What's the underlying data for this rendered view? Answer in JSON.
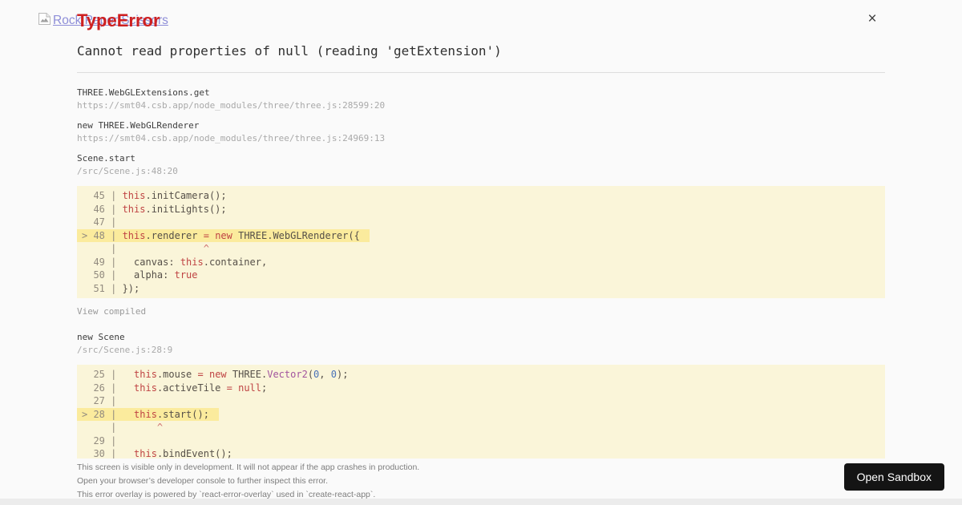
{
  "header": {
    "title": "TypeError",
    "message": "Cannot read properties of null (reading 'getExtension')",
    "broken_image_alt": "Rock Paper Scissors",
    "close_label": "×"
  },
  "stack_frames": [
    {
      "fn": "THREE.WebGLExtensions.get",
      "loc": "https://smt04.csb.app/node_modules/three/three.js:28599:20"
    },
    {
      "fn": "new THREE.WebGLRenderer",
      "loc": "https://smt04.csb.app/node_modules/three/three.js:24969:13"
    },
    {
      "fn": "Scene.start",
      "loc": "/src/Scene.js:48:20",
      "code": 0,
      "after_link": "View compiled"
    },
    {
      "fn": "new Scene",
      "loc": "/src/Scene.js:28:9",
      "code": 1
    }
  ],
  "code_blocks": [
    {
      "lines": [
        {
          "gutter": "  45 | ",
          "tokens": [
            [
              "kw",
              "this"
            ],
            [
              "pl",
              ".initCamera();"
            ]
          ]
        },
        {
          "gutter": "  46 | ",
          "tokens": [
            [
              "kw",
              "this"
            ],
            [
              "pl",
              ".initLights();"
            ]
          ]
        },
        {
          "gutter": "  47 | ",
          "tokens": []
        },
        {
          "gutter": "> 48 | ",
          "highlight": true,
          "tokens": [
            [
              "kw",
              "this"
            ],
            [
              "pl",
              ".renderer "
            ],
            [
              "kw",
              "= "
            ],
            [
              "kw",
              "new "
            ],
            [
              "pl",
              "THREE.WebGLRenderer({"
            ]
          ]
        },
        {
          "gutter": "     | ",
          "tokens": [
            [
              "caret",
              "              ^"
            ]
          ]
        },
        {
          "gutter": "  49 | ",
          "tokens": [
            [
              "pl",
              "  canvas: "
            ],
            [
              "kw",
              "this"
            ],
            [
              "pl",
              ".container,"
            ]
          ]
        },
        {
          "gutter": "  50 | ",
          "tokens": [
            [
              "pl",
              "  alpha: "
            ],
            [
              "kw",
              "true"
            ]
          ]
        },
        {
          "gutter": "  51 | ",
          "tokens": [
            [
              "pl",
              "});"
            ]
          ]
        }
      ]
    },
    {
      "lines": [
        {
          "gutter": "  25 | ",
          "tokens": [
            [
              "pl",
              "  "
            ],
            [
              "kw",
              "this"
            ],
            [
              "pl",
              ".mouse "
            ],
            [
              "kw",
              "= "
            ],
            [
              "kw",
              "new "
            ],
            [
              "pl",
              "THREE."
            ],
            [
              "cls",
              "Vector2"
            ],
            [
              "pl",
              "("
            ],
            [
              "num",
              "0"
            ],
            [
              "pl",
              ", "
            ],
            [
              "num",
              "0"
            ],
            [
              "pl",
              ");"
            ]
          ]
        },
        {
          "gutter": "  26 | ",
          "tokens": [
            [
              "pl",
              "  "
            ],
            [
              "kw",
              "this"
            ],
            [
              "pl",
              ".activeTile "
            ],
            [
              "kw",
              "= "
            ],
            [
              "kw",
              "null"
            ],
            [
              "pl",
              ";"
            ]
          ]
        },
        {
          "gutter": "  27 | ",
          "tokens": []
        },
        {
          "gutter": "> 28 | ",
          "highlight": true,
          "tokens": [
            [
              "pl",
              "  "
            ],
            [
              "kw",
              "this"
            ],
            [
              "pl",
              ".start();"
            ]
          ]
        },
        {
          "gutter": "     | ",
          "tokens": [
            [
              "caret",
              "      ^"
            ]
          ]
        },
        {
          "gutter": "  29 | ",
          "tokens": []
        },
        {
          "gutter": "  30 | ",
          "tokens": [
            [
              "pl",
              "  "
            ],
            [
              "kw",
              "this"
            ],
            [
              "pl",
              ".bindEvent();"
            ]
          ]
        }
      ]
    }
  ],
  "footer": {
    "lines": [
      "This screen is visible only in development. It will not appear if the app crashes in production.",
      "Open your browser’s developer console to further inspect this error.",
      "This error overlay is powered by `react-error-overlay` used in `create-react-app`."
    ],
    "open_sandbox_label": "Open Sandbox"
  },
  "colors": {
    "page_bg": "#fafafa",
    "title_red": "#ce2020",
    "code_bg": "#faf5d9",
    "code_highlight_bg": "#fbeb9d",
    "keyword_red": "#bf4343",
    "class_purple": "#a2549e",
    "number_blue": "#4a72b8",
    "button_bg": "#141414",
    "alt_link": "#8e8ed8"
  }
}
